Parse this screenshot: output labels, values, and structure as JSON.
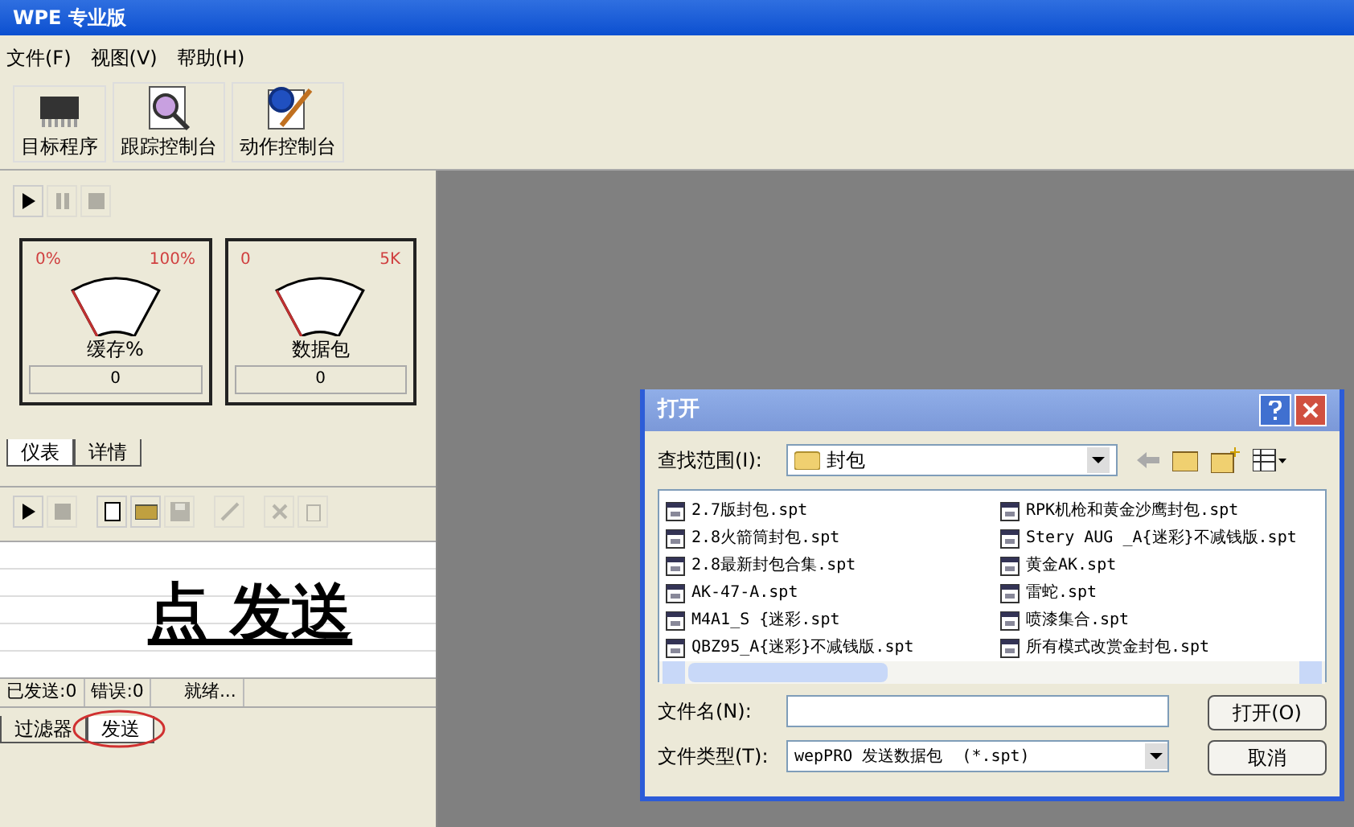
{
  "window": {
    "title": "WPE 专业版"
  },
  "menu": [
    "文件(F)",
    "视图(V)",
    "帮助(H)"
  ],
  "toolbar": [
    {
      "kind": "chip",
      "label": "目标程序"
    },
    {
      "kind": "trace",
      "label": "跟踪控制台"
    },
    {
      "kind": "action",
      "label": "动作控制台"
    }
  ],
  "gauges": [
    {
      "min_label": "0%",
      "max_label": "100%",
      "caption": "缓存%",
      "reading": "0"
    },
    {
      "min_label": "0",
      "max_label": "5K",
      "caption": "数据包",
      "reading": "0"
    }
  ],
  "top_tabs": [
    {
      "label": "仪表",
      "selected": true
    },
    {
      "label": "详情",
      "selected": false
    }
  ],
  "annotation": "点 发送",
  "status": [
    "已发送:0",
    "错误:0",
    "就绪..."
  ],
  "bottom_tabs": [
    {
      "label": "过滤器",
      "selected": false
    },
    {
      "label": "发送",
      "selected": true,
      "circled": true
    }
  ],
  "dialog": {
    "title": "打开",
    "look_in_label": "查找范围(I):",
    "look_in": "封包",
    "files": [
      "2.7版封包.spt",
      "2.8火箭筒封包.spt",
      "2.8最新封包合集.spt",
      "AK-47-A.spt",
      "M4A1_S  {迷彩.spt",
      "QBZ95_A{迷彩}不减钱版.spt",
      "RPK机枪和黄金沙鹰封包.spt",
      "Stery AUG _A{迷彩}不减钱版.spt",
      "黄金AK.spt",
      "雷蛇.spt",
      "喷漆集合.spt",
      "所有模式改赏金封包.spt"
    ],
    "filename_label": "文件名(N):",
    "filetype_label": "文件类型(T):",
    "filetype": "wepPRO 发送数据包  (*.spt)",
    "buttons": [
      "打开(O)",
      "取消"
    ]
  }
}
